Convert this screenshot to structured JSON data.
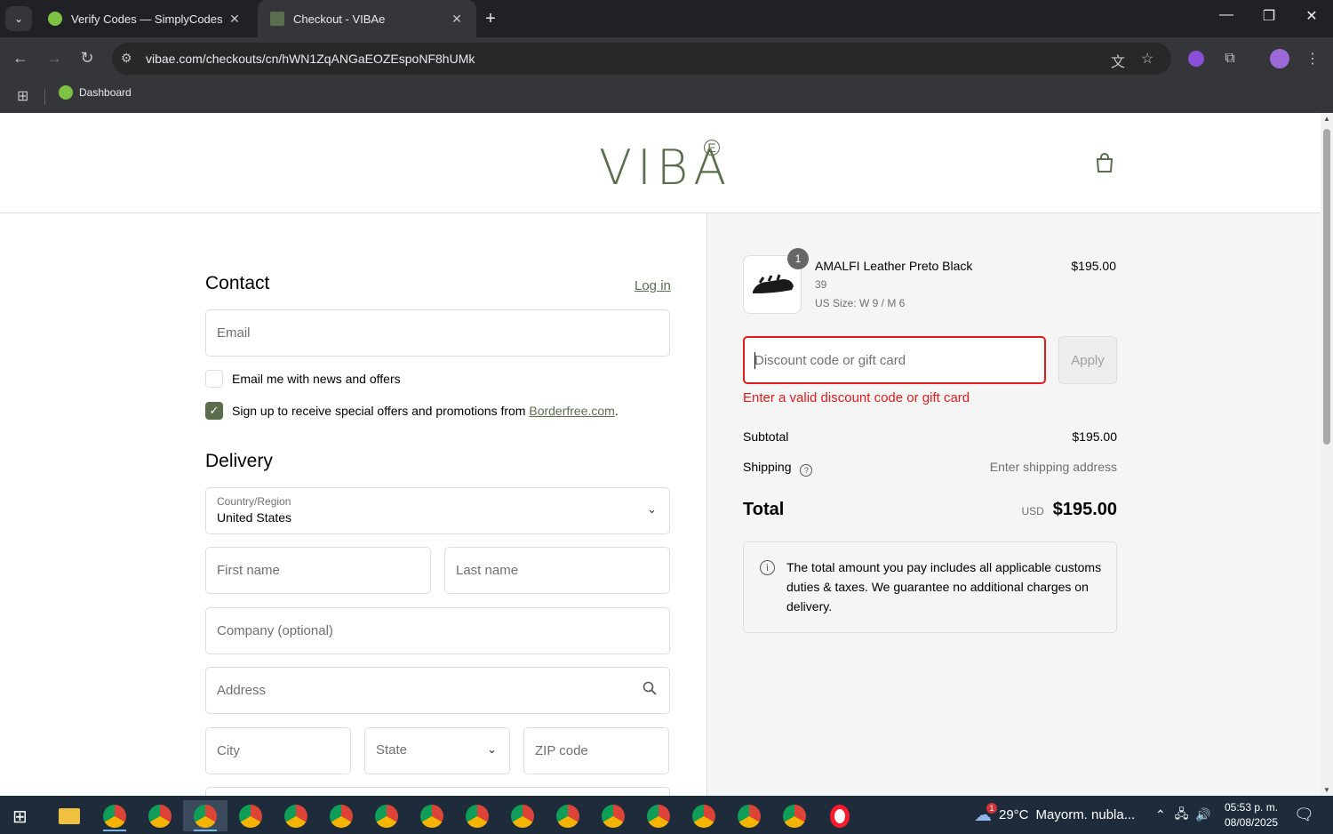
{
  "browser": {
    "tabs": [
      {
        "title": "Verify Codes — SimplyCodes",
        "favicon_color": "#7dc243"
      },
      {
        "title": "Checkout - VIBAe",
        "favicon_color": "#5a6e4e"
      }
    ],
    "url": "vibae.com/checkouts/cn/hWN1ZqANGaEOZEspoNF8hUMk",
    "bookmarks": [
      {
        "label": "Dashboard"
      }
    ]
  },
  "store": {
    "logo": "VIBA",
    "logo_mark": "E",
    "brand_color": "#5a6e4e"
  },
  "contact": {
    "heading": "Contact",
    "login_link": "Log in",
    "email_placeholder": "Email",
    "news_checkbox_label": "Email me with news and offers",
    "news_checked": false,
    "promo_checkbox_label_prefix": "Sign up to receive special offers and promotions from ",
    "promo_checkbox_link": "Borderfree.com",
    "promo_checkbox_label_suffix": ".",
    "promo_checked": true
  },
  "delivery": {
    "heading": "Delivery",
    "country_label": "Country/Region",
    "country_value": "United States",
    "first_name_placeholder": "First name",
    "last_name_placeholder": "Last name",
    "company_placeholder": "Company (optional)",
    "address_placeholder": "Address",
    "city_placeholder": "City",
    "state_placeholder": "State",
    "zip_placeholder": "ZIP code"
  },
  "summary": {
    "item": {
      "quantity": "1",
      "name": "AMALFI Leather Preto Black",
      "size": "39",
      "us_size": "US Size: W 9 / M 6",
      "price": "$195.00"
    },
    "discount_placeholder": "Discount code or gift card",
    "apply_label": "Apply",
    "error": "Enter a valid discount code or gift card",
    "subtotal_label": "Subtotal",
    "subtotal_value": "$195.00",
    "shipping_label": "Shipping",
    "shipping_value": "Enter shipping address",
    "total_label": "Total",
    "currency": "USD",
    "total_value": "$195.00",
    "info_text": "The total amount you pay includes all applicable customs duties & taxes. We guarantee no additional charges on delivery."
  },
  "taskbar": {
    "weather_temp": "29°C",
    "weather_desc": "Mayorm. nubla...",
    "weather_badge": "1",
    "time": "05:53 p. m.",
    "date": "08/08/2025"
  }
}
